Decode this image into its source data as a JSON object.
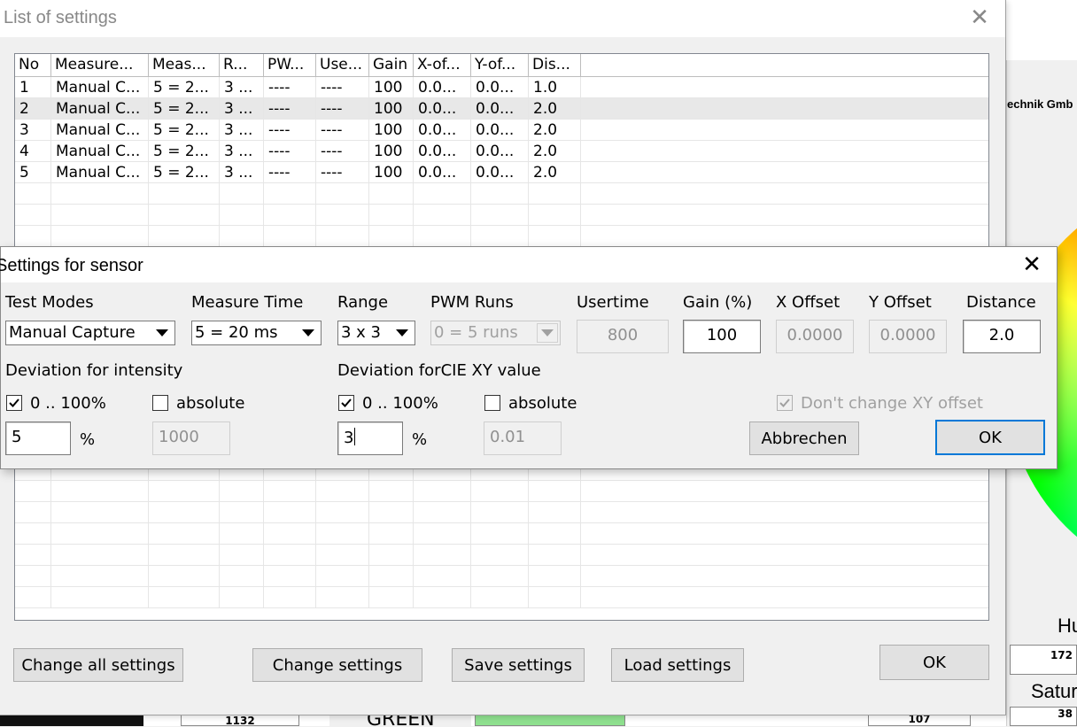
{
  "background": {
    "company_text": "echnik Gmb",
    "hue_label": "Hu",
    "hue_value": "172",
    "sat_label": "Satur",
    "sat_value": "38",
    "bottom_values": [
      "1132",
      "GREEN",
      "107"
    ]
  },
  "list_window": {
    "title": "List of settings",
    "columns": [
      "No",
      "Measure...",
      "Meas...",
      "R...",
      "PW...",
      "Use...",
      "Gain",
      "X-of...",
      "Y-of...",
      "Dis..."
    ],
    "rows": [
      [
        "1",
        "Manual C...",
        "5 = 2...",
        "3 ...",
        "----",
        "----",
        "100",
        "0.0...",
        "0.0...",
        "1.0"
      ],
      [
        "2",
        "Manual C...",
        "5 = 2...",
        "3 ...",
        "----",
        "----",
        "100",
        "0.0...",
        "0.0...",
        "2.0"
      ],
      [
        "3",
        "Manual C...",
        "5 = 2...",
        "3 ...",
        "----",
        "----",
        "100",
        "0.0...",
        "0.0...",
        "2.0"
      ],
      [
        "4",
        "Manual C...",
        "5 = 2...",
        "3 ...",
        "----",
        "----",
        "100",
        "0.0...",
        "0.0...",
        "2.0"
      ],
      [
        "5",
        "Manual C...",
        "5 = 2...",
        "3 ...",
        "----",
        "----",
        "100",
        "0.0...",
        "0.0...",
        "2.0"
      ]
    ],
    "selected_row": 2,
    "buttons": {
      "change_all": "Change all settings",
      "change": "Change settings",
      "save": "Save settings",
      "load": "Load settings",
      "ok": "OK"
    }
  },
  "dialog": {
    "title": "Settings for sensor",
    "labels": {
      "test_modes": "Test Modes",
      "measure_time": "Measure Time",
      "range": "Range",
      "pwm_runs": "PWM Runs",
      "usertime": "Usertime",
      "gain": "Gain (%)",
      "x_offset": "X Offset",
      "y_offset": "Y Offset",
      "distance": "Distance",
      "dev_intensity": "Deviation for intensity",
      "dev_cie": "Deviation forCIE XY value"
    },
    "values": {
      "test_mode": "Manual Capture",
      "measure_time": "5 = 20 ms",
      "range": "3 x 3",
      "pwm_runs": "0 = 5 runs",
      "usertime": "800",
      "gain": "100",
      "x_offset": "0.0000",
      "y_offset": "0.0000",
      "distance": "2.0"
    },
    "intensity": {
      "pct_label": "0 .. 100%",
      "pct_checked": true,
      "abs_label": "absolute",
      "abs_checked": false,
      "pct_value": "5",
      "pct_unit": "%",
      "abs_value": "1000"
    },
    "cie": {
      "pct_label": "0 .. 100%",
      "pct_checked": true,
      "abs_label": "absolute",
      "abs_checked": false,
      "pct_value": "3",
      "pct_unit": "%",
      "abs_value": "0.01"
    },
    "dont_change_xy": {
      "label": "Don't change XY offset",
      "checked": true
    },
    "buttons": {
      "cancel": "Abbrechen",
      "ok": "OK"
    }
  }
}
